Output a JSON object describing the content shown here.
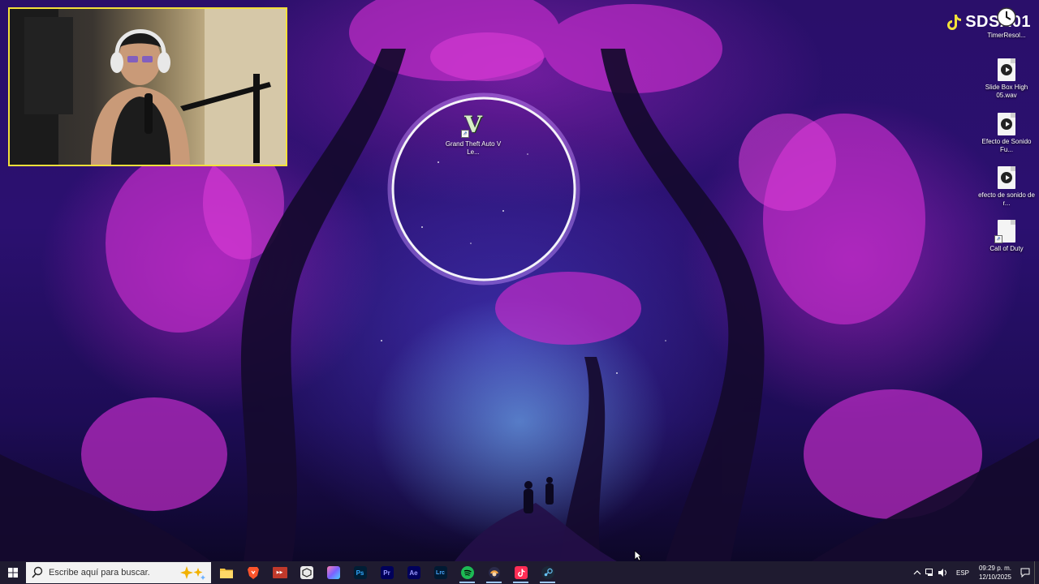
{
  "watermark": {
    "text": "SDSA01",
    "icon": "tiktok-icon"
  },
  "desktop_icons": [
    {
      "label": "TimerResol...",
      "icon": "clock-icon"
    },
    {
      "label": "Slide Box High 05.wav",
      "icon": "audio-file-icon"
    },
    {
      "label": "Efecto de Sonido Fu...",
      "icon": "audio-file-icon"
    },
    {
      "label": "efecto de sonido de r...",
      "icon": "audio-file-icon"
    },
    {
      "label": "Call of Duty",
      "icon": "blank-file-shortcut-icon"
    },
    {
      "label": "Grand Theft Auto V Le...",
      "icon": "gta-v-icon",
      "glyph": "V"
    }
  ],
  "taskbar": {
    "search_placeholder": "Escribe aquí para buscar.",
    "apps": [
      {
        "name": "file-explorer",
        "label": "",
        "color": "#f4c542"
      },
      {
        "name": "brave",
        "label": "",
        "color": "#fb542b"
      },
      {
        "name": "video-maker",
        "label": "",
        "color": "#c0392b"
      },
      {
        "name": "unity-hub",
        "label": "",
        "color": "#eaeaea"
      },
      {
        "name": "photos",
        "label": "",
        "color": "#7b61ff"
      },
      {
        "name": "photoshop",
        "label": "Ps",
        "color": "#31a8ff"
      },
      {
        "name": "premiere",
        "label": "Pr",
        "color": "#9999ff"
      },
      {
        "name": "after-effects",
        "label": "Ae",
        "color": "#9999ff"
      },
      {
        "name": "lightroom-classic",
        "label": "Lrc",
        "color": "#4aa8ff"
      },
      {
        "name": "spotify",
        "label": "",
        "color": "#1db954"
      },
      {
        "name": "streamlabs-character",
        "label": "",
        "color": "#f0a040"
      },
      {
        "name": "tiktok-live",
        "label": "",
        "color": "#ff2d55"
      },
      {
        "name": "steam",
        "label": "",
        "color": "#66c0f4"
      }
    ],
    "tray": {
      "language": "ESP",
      "time": "09:29 p. m.",
      "date": "12/10/2025"
    }
  }
}
